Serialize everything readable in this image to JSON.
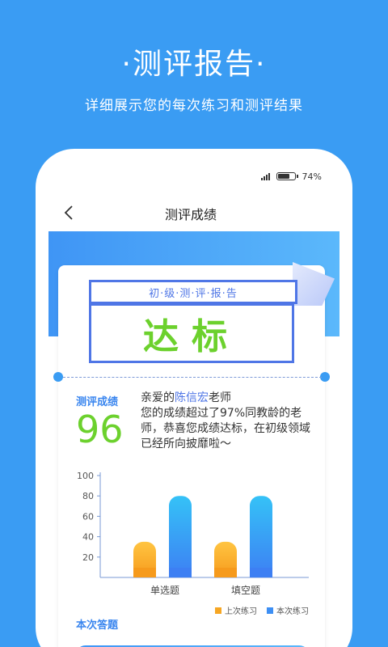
{
  "banner": {
    "title": "·测评报告·",
    "subtitle": "详细展示您的每次练习和测评结果"
  },
  "status_bar": {
    "battery_text": "74%",
    "battery_level": 0.74
  },
  "nav": {
    "title": "测评成绩",
    "back_icon": "chevron-left-icon"
  },
  "report": {
    "stamp_label": "初·级·测·评·报·告",
    "stamp_result": "达标",
    "score_label": "测评成绩",
    "score_value": "96",
    "message_prefix": "亲爱的",
    "teacher_name": "陈信宏",
    "message_suffix": "老师",
    "message_body": "您的成绩超过了97%同教龄的老师，恭喜您成绩达标，在初级领域已经所向披靡啦～"
  },
  "chart_data": {
    "type": "bar",
    "categories": [
      "单选题",
      "填空题"
    ],
    "series": [
      {
        "name": "上次练习",
        "values": [
          35,
          35
        ],
        "color": "#f6a623"
      },
      {
        "name": "本次练习",
        "values": [
          80,
          80
        ],
        "color": "#3d8ff4"
      }
    ],
    "yticks": [
      20,
      40,
      60,
      80,
      100
    ],
    "ylim": [
      0,
      100
    ],
    "legend_position": "bottom-right",
    "grid": false
  },
  "answers": {
    "section_title": "本次答题"
  },
  "colors": {
    "background": "#3a9cf3",
    "accent_blue": "#4f76e6",
    "pass_green": "#6cd12d",
    "last_practice": "#f6a623",
    "this_practice": "#3d8ff4"
  }
}
